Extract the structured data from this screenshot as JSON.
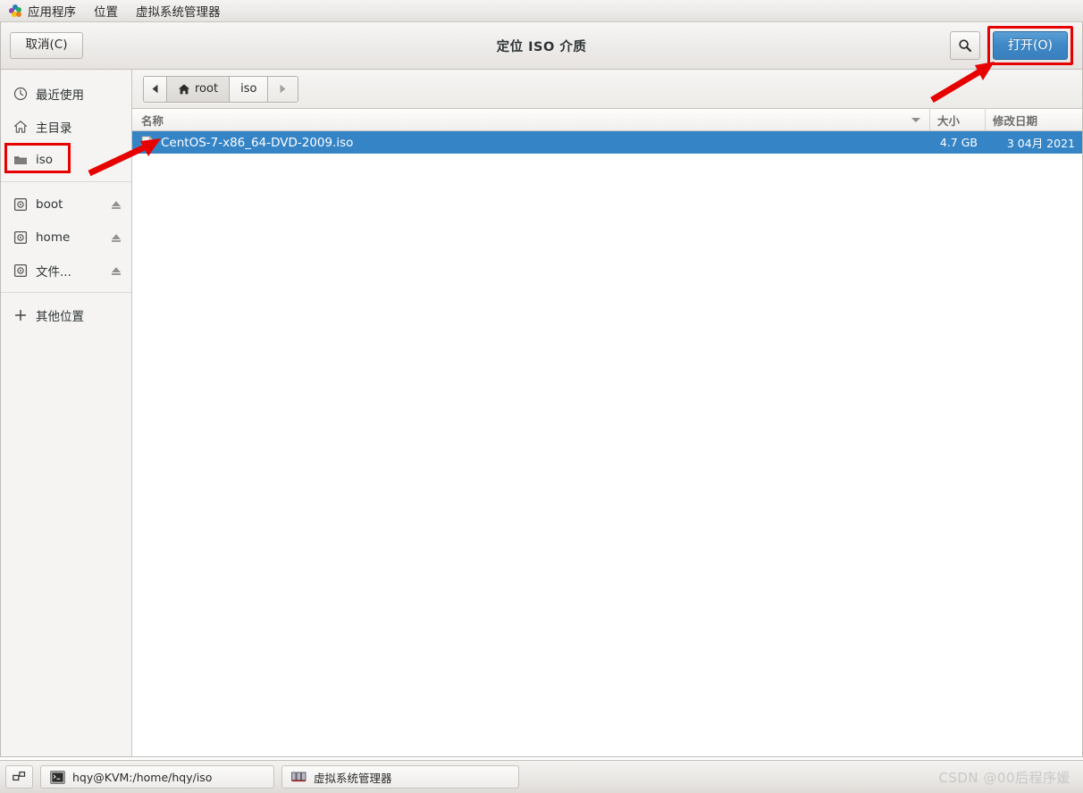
{
  "topbar": {
    "items": [
      {
        "label": "应用程序",
        "icon": "applications-icon"
      },
      {
        "label": "位置",
        "icon": null
      },
      {
        "label": "虚拟系统管理器",
        "icon": null
      }
    ]
  },
  "dialog": {
    "title": "定位 ISO 介质",
    "cancel_label": "取消(C)",
    "open_label": "打开(O)",
    "search_icon": "search-icon"
  },
  "sidebar": {
    "items": [
      {
        "label": "最近使用",
        "icon": "clock-icon",
        "eject": false,
        "highlighted": false
      },
      {
        "label": "主目录",
        "icon": "home-icon",
        "eject": false,
        "highlighted": false
      },
      {
        "label": "iso",
        "icon": "folder-icon",
        "eject": false,
        "highlighted": true
      },
      {
        "label": "boot",
        "icon": "drive-icon",
        "eject": true,
        "highlighted": false
      },
      {
        "label": "home",
        "icon": "drive-icon",
        "eject": true,
        "highlighted": false
      },
      {
        "label": "文件...",
        "icon": "drive-icon",
        "eject": true,
        "highlighted": false
      },
      {
        "label": "其他位置",
        "icon": "plus-icon",
        "eject": false,
        "highlighted": false
      }
    ]
  },
  "pathbar": {
    "back_icon": "triangle-left-icon",
    "forward_icon": "triangle-right-icon",
    "segments": [
      {
        "label": "root",
        "icon": "home-icon",
        "current": false
      },
      {
        "label": "iso",
        "icon": null,
        "current": true
      }
    ]
  },
  "filelist": {
    "columns": {
      "name": "名称",
      "size": "大小",
      "modified": "修改日期"
    },
    "rows": [
      {
        "name": "CentOS-7-x86_64-DVD-2009.iso",
        "size": "4.7 GB",
        "modified": "3 04月 2021",
        "icon": "iso-file-icon",
        "selected": true
      }
    ]
  },
  "taskbar": {
    "show_desktop_icon": "show-desktop-icon",
    "tasks": [
      {
        "label": "hqy@KVM:/home/hqy/iso",
        "icon": "terminal-icon"
      },
      {
        "label": "虚拟系统管理器",
        "icon": "virt-manager-icon"
      }
    ],
    "watermark": "CSDN @00后程序媛"
  },
  "colors": {
    "selection_blue": "#3584c6",
    "annotation_red": "#e60000",
    "open_button_blue": "#3e87c6"
  }
}
